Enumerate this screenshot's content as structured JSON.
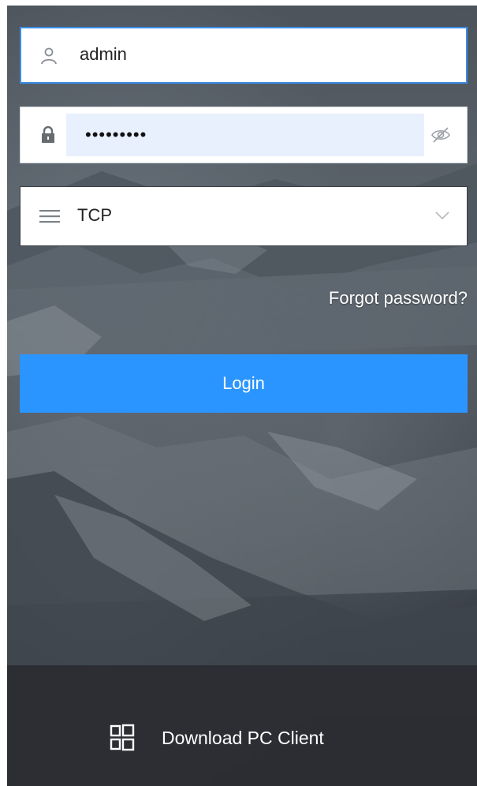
{
  "login": {
    "username": "admin",
    "password_masked": "•••••••••",
    "protocol": "TCP",
    "forgot_label": "Forgot password?",
    "login_label": "Login",
    "download_label": "Download PC Client"
  },
  "icons": {
    "user": "user-icon",
    "lock": "lock-icon",
    "eye_hidden": "eye-slash-icon",
    "menu": "menu-icon",
    "chevron": "chevron-down-icon",
    "windows": "windows-icon"
  },
  "colors": {
    "primary": "#2b95ff",
    "focus_border": "#3a8de6",
    "autofill": "#e8f0fe",
    "text": "#222222"
  }
}
